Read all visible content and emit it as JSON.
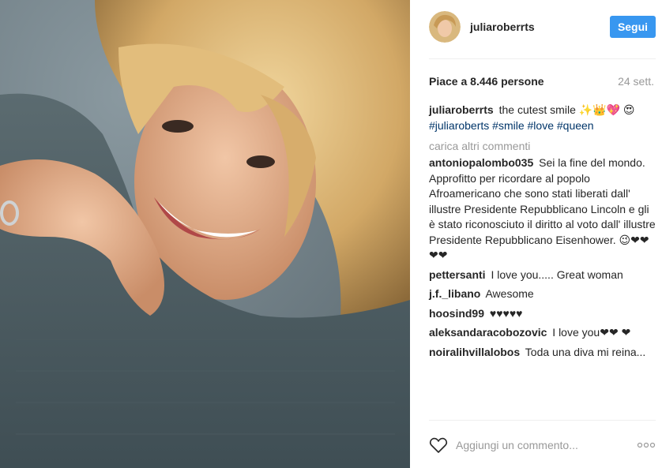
{
  "post": {
    "username": "juliaroberrts",
    "follow_label": "Segui",
    "likes": "Piace a 8.446 persone",
    "date": "24 sett.",
    "caption_text": "the cutest smile ✨👑💖 😍",
    "caption_tags": [
      "#juliaroberts",
      "#smile",
      "#love",
      "#queen"
    ],
    "load_more": "carica altri commenti",
    "add_comment_placeholder": "Aggiungi un commento...",
    "more_options": "ooo"
  },
  "comments": [
    {
      "user": "antoniopalombo035",
      "text": "Sei la fine del mondo. Approfitto per ricordare al popolo Afroamericano che sono stati liberati dall' illustre Presidente Repubblicano Lincoln e gli è stato riconosciuto il diritto al voto dall' illustre Presidente Repubblicano Eisenhower. 😉❤❤❤❤"
    },
    {
      "user": "pettersanti",
      "text": "I love you..... Great woman"
    },
    {
      "user": "j.f._libano",
      "text": "Awesome"
    },
    {
      "user": "hoosind99",
      "text": "♥♥♥♥♥"
    },
    {
      "user": "aleksandaracobozovic",
      "text": "I love you❤❤ ❤"
    },
    {
      "user": "noiralihvillalobos",
      "text": "Toda una diva mi reina..."
    }
  ],
  "colors": {
    "follow_button": "#3897f0",
    "hashtag": "#003569",
    "muted_text": "#999999"
  },
  "icons": [
    "avatar",
    "heart-icon",
    "more-options-icon"
  ]
}
